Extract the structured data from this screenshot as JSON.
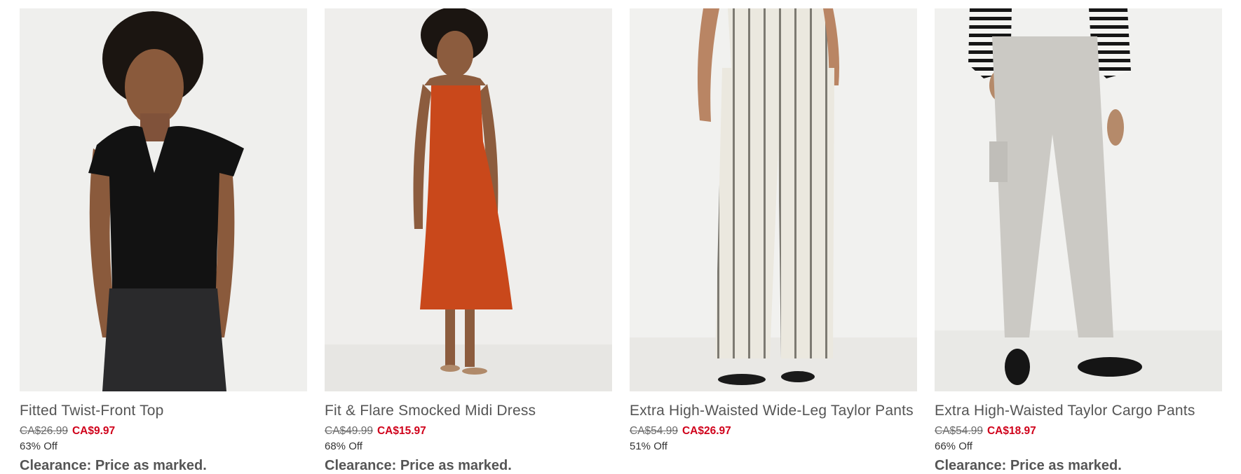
{
  "products": [
    {
      "name": "Fitted Twist-Front Top",
      "was_price": "CA$26.99",
      "now_price": "CA$9.97",
      "discount": "63% Off",
      "note": "Clearance: Price as marked.",
      "image": {
        "subject": "woman in black twist-front top",
        "primary_color": "#111111"
      }
    },
    {
      "name": "Fit & Flare Smocked Midi Dress",
      "was_price": "CA$49.99",
      "now_price": "CA$15.97",
      "discount": "68% Off",
      "note": "Clearance: Price as marked.",
      "image": {
        "subject": "woman in orange smocked midi dress",
        "primary_color": "#c9481b"
      }
    },
    {
      "name": "Extra High-Waisted Wide-Leg Taylor Pants",
      "was_price": "CA$54.99",
      "now_price": "CA$26.97",
      "discount": "51% Off",
      "note": "",
      "image": {
        "subject": "striped linen wide-leg pants",
        "primary_color": "#e8e5dc"
      }
    },
    {
      "name": "Extra High-Waisted Taylor Cargo Pants",
      "was_price": "CA$54.99",
      "now_price": "CA$18.97",
      "discount": "66% Off",
      "note": "Clearance: Price as marked.",
      "image": {
        "subject": "light grey cargo pants",
        "primary_color": "#c9c7c2"
      }
    }
  ],
  "colors": {
    "sale_price": "#d0021b",
    "text": "#555555",
    "image_background": "#f0f0ef"
  }
}
